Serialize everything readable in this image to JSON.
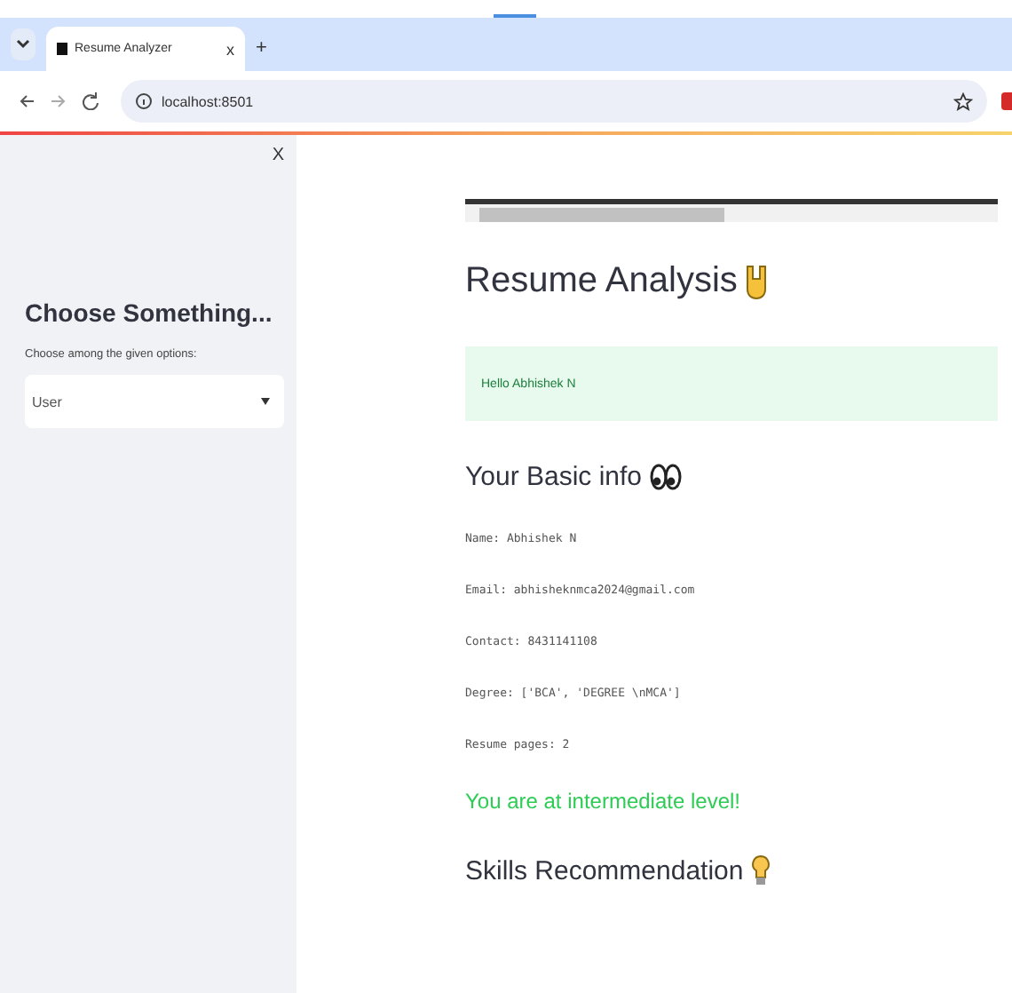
{
  "browser": {
    "tab_title": "Resume Analyzer",
    "tab_close": "x",
    "new_tab": "+",
    "address": "localhost:8501"
  },
  "sidebar": {
    "close": "X",
    "heading": "Choose Something...",
    "select_label": "Choose among the given options:",
    "select_value": "User"
  },
  "main": {
    "title": "Resume Analysis",
    "success": "Hello Abhishek N",
    "info_heading": "Your Basic info",
    "info_lines": [
      "Name: Abhishek N",
      "Email: abhisheknmca2024@gmail.com",
      "Contact: 8431141108",
      "Degree: ['BCA', 'DEGREE \\nMCA']",
      "Resume pages: 2"
    ],
    "level_text": "You are at intermediate level!",
    "skills_heading": "Skills Recommendation"
  }
}
